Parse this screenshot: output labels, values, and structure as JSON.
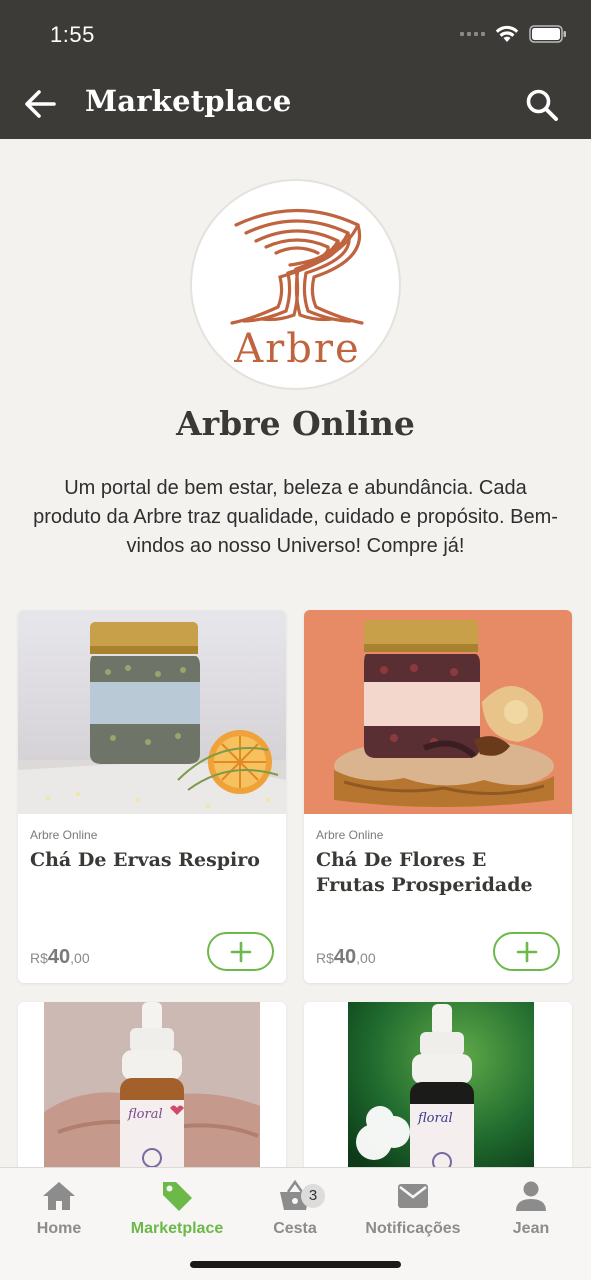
{
  "status": {
    "time": "1:55"
  },
  "appbar": {
    "title": "Marketplace",
    "back_icon": "arrow-left-icon",
    "search_icon": "search-icon"
  },
  "store": {
    "name": "Arbre Online",
    "logo_text": "Arbre",
    "description": "Um portal de bem estar, beleza e abundância. Cada produto da Arbre traz qualidade, cuidado e propósito. Bem-vindos ao nosso Universo! Compre já!"
  },
  "products": [
    {
      "seller": "Arbre Online",
      "name": "Chá De Ervas Respiro",
      "currency": "R$",
      "price_int": "40",
      "price_dec": ",00"
    },
    {
      "seller": "Arbre Online",
      "name": "Chá De Flores E Frutas Prosperidade",
      "currency": "R$",
      "price_int": "40",
      "price_dec": ",00"
    },
    {
      "label_brand": "floral"
    },
    {
      "label_brand": "floral"
    }
  ],
  "nav": {
    "items": [
      {
        "label": "Home",
        "icon": "home-icon"
      },
      {
        "label": "Marketplace",
        "icon": "tag-icon",
        "active": true
      },
      {
        "label": "Cesta",
        "icon": "basket-icon",
        "badge": "3"
      },
      {
        "label": "Notificações",
        "icon": "envelope-icon"
      },
      {
        "label": "Jean",
        "icon": "user-icon"
      }
    ]
  },
  "colors": {
    "accent": "#6cb94a",
    "appbar": "#3c3b38",
    "logo": "#c0643f",
    "background": "#f4f2ef"
  }
}
